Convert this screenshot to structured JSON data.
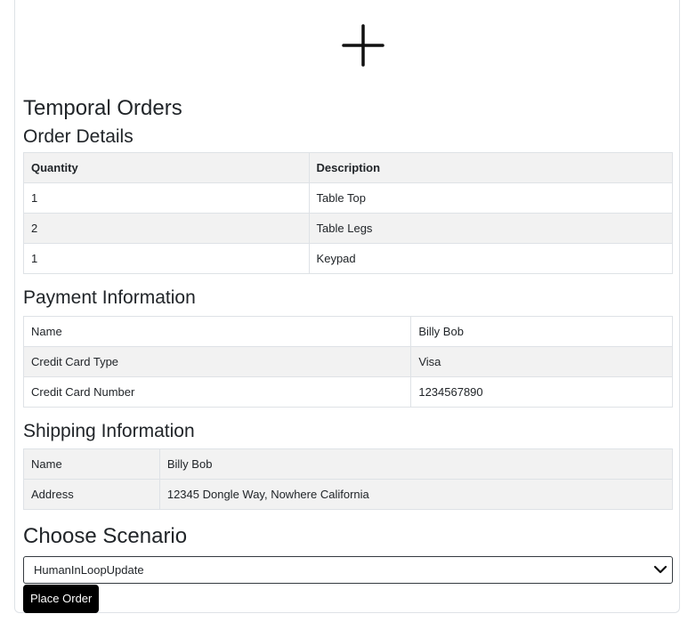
{
  "page": {
    "title": "Temporal Orders",
    "logo_icon": "plus-icon"
  },
  "order_details": {
    "heading": "Order Details",
    "columns": [
      "Quantity",
      "Description"
    ],
    "rows": [
      {
        "quantity": "1",
        "description": "Table Top"
      },
      {
        "quantity": "2",
        "description": "Table Legs"
      },
      {
        "quantity": "1",
        "description": "Keypad"
      }
    ]
  },
  "payment": {
    "heading": "Payment Information",
    "rows": [
      {
        "label": "Name",
        "value": "Billy Bob"
      },
      {
        "label": "Credit Card Type",
        "value": "Visa"
      },
      {
        "label": "Credit Card Number",
        "value": "1234567890"
      }
    ]
  },
  "shipping": {
    "heading": "Shipping Information",
    "rows": [
      {
        "label": "Name",
        "value": "Billy Bob"
      },
      {
        "label": "Address",
        "value": "12345 Dongle Way, Nowhere California"
      }
    ]
  },
  "scenario": {
    "heading": "Choose Scenario",
    "selected": "HumanInLoopUpdate",
    "chevron_icon": "chevron-down-icon"
  },
  "actions": {
    "place_order_label": "Place Order"
  },
  "colors": {
    "table_stripe": "#f2f2f2",
    "border": "#dee2e6",
    "button_bg": "#000000",
    "button_text": "#ffffff"
  }
}
